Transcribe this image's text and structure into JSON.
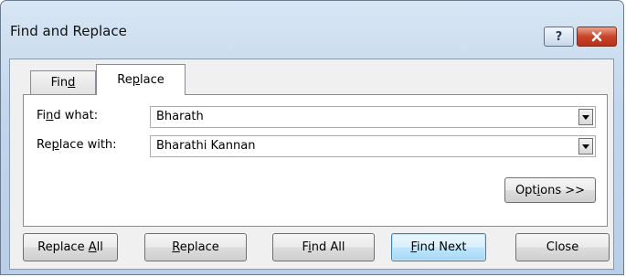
{
  "window": {
    "title": "Find and Replace",
    "help_glyph": "?"
  },
  "tabs": [
    {
      "pre": "Fin",
      "acc": "d",
      "post": "",
      "selected": false
    },
    {
      "pre": "Re",
      "acc": "p",
      "post": "lace",
      "selected": true
    }
  ],
  "find": {
    "label_pre": "Fi",
    "label_acc": "n",
    "label_post": "d what:",
    "value": "Bharath"
  },
  "replace": {
    "label_pre": "Re",
    "label_acc": "p",
    "label_post": "lace with:",
    "value": "Bharathi Kannan"
  },
  "options_button": {
    "pre": "Opt",
    "acc": "i",
    "post": "ons >>"
  },
  "buttons": {
    "replace_all": {
      "pre": "Replace ",
      "acc": "A",
      "post": "ll"
    },
    "replace": {
      "pre": "",
      "acc": "R",
      "post": "eplace"
    },
    "find_all": {
      "pre": "F",
      "acc": "i",
      "post": "nd All"
    },
    "find_next": {
      "pre": "",
      "acc": "F",
      "post": "ind Next"
    },
    "close": {
      "label": "Close"
    }
  },
  "colors": {
    "frame": "#c2d6ec",
    "close_button": "#c9442a",
    "default_button_border": "#3c7fb1"
  }
}
